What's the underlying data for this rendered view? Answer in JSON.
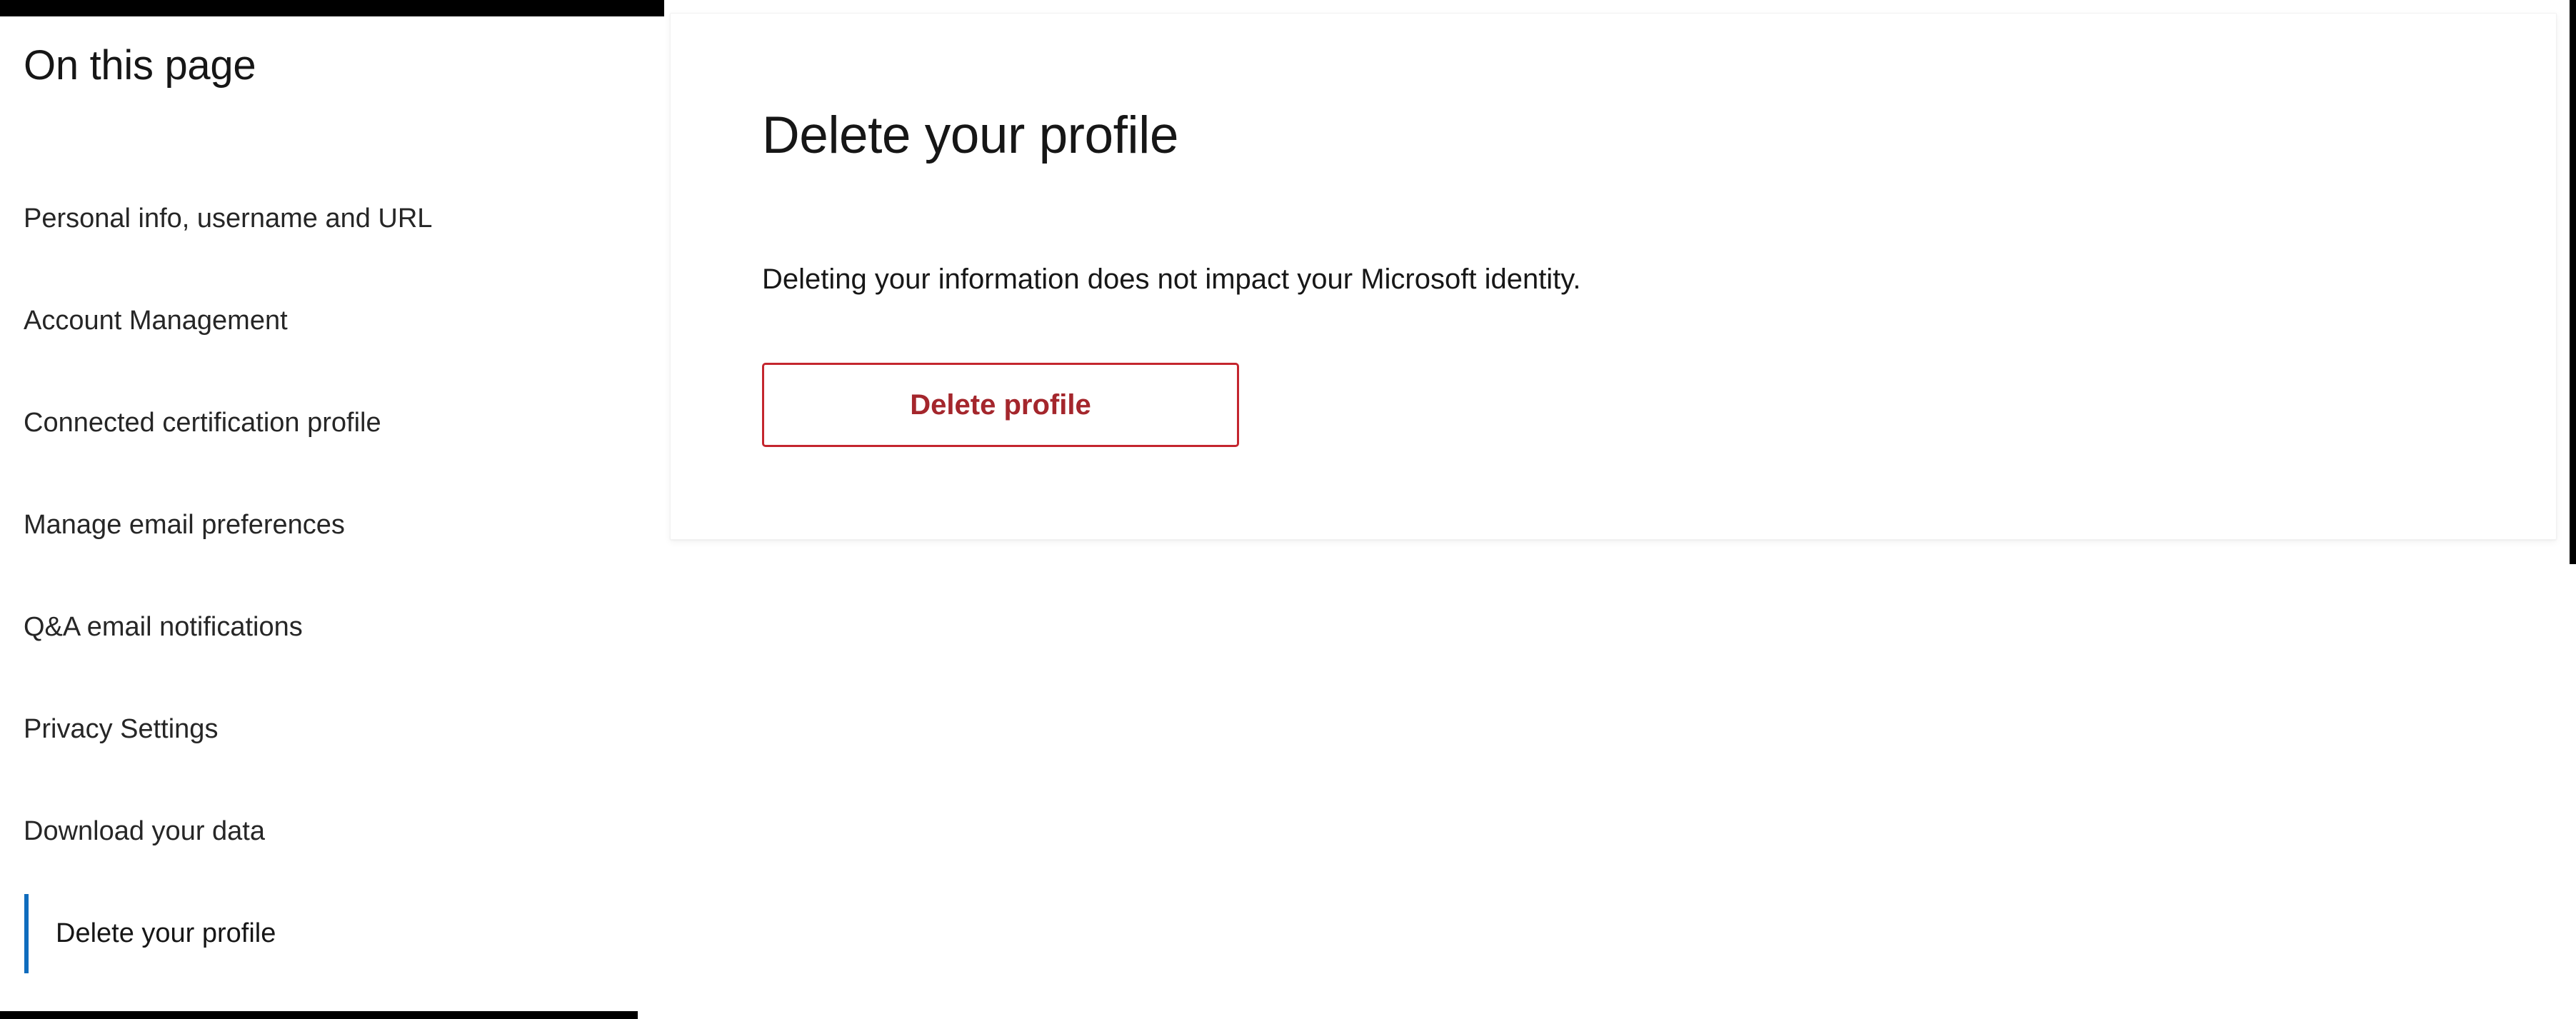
{
  "sidebar": {
    "title": "On this page",
    "items": [
      {
        "label": "Personal info, username and URL",
        "active": false
      },
      {
        "label": "Account Management",
        "active": false
      },
      {
        "label": "Connected certification profile",
        "active": false
      },
      {
        "label": "Manage email preferences",
        "active": false
      },
      {
        "label": "Q&A email notifications",
        "active": false
      },
      {
        "label": "Privacy Settings",
        "active": false
      },
      {
        "label": "Download your data",
        "active": false
      },
      {
        "label": "Delete your profile",
        "active": true
      }
    ],
    "active_indicator_color": "#0f6cbd"
  },
  "main": {
    "heading": "Delete your profile",
    "description": "Deleting your information does not impact your Microsoft identity.",
    "delete_button_label": "Delete profile",
    "delete_button_border_color": "#c4262e",
    "delete_button_text_color": "#a4262c"
  },
  "theme": {
    "page_background": "#ffffff",
    "card_background": "#ffffff",
    "text_primary": "#161616",
    "text_secondary": "#262626",
    "chrome_color": "#000000"
  }
}
